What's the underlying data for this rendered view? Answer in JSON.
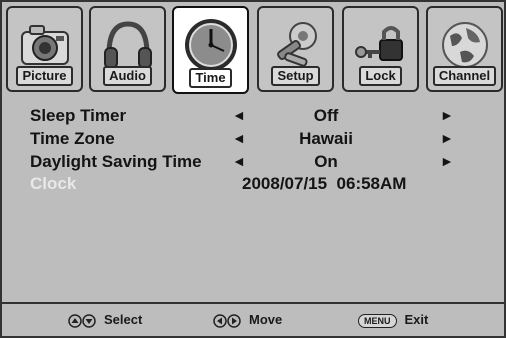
{
  "tabs": [
    {
      "label": "Picture",
      "icon": "camera-icon"
    },
    {
      "label": "Audio",
      "icon": "headphones-icon"
    },
    {
      "label": "Time",
      "icon": "clock-icon",
      "active": true
    },
    {
      "label": "Setup",
      "icon": "tools-icon"
    },
    {
      "label": "Lock",
      "icon": "lock-key-icon"
    },
    {
      "label": "Channel",
      "icon": "globe-icon"
    }
  ],
  "settings": {
    "sleep_timer": {
      "label": "Sleep Timer",
      "value": "Off"
    },
    "time_zone": {
      "label": "Time Zone",
      "value": "Hawaii"
    },
    "daylight_saving": {
      "label": "Daylight Saving Time",
      "value": "On"
    },
    "clock": {
      "label": "Clock",
      "value": "2008/07/15  06:58AM"
    }
  },
  "arrows": {
    "left": "◄",
    "right": "►"
  },
  "footer": {
    "select_label": "Select",
    "move_label": "Move",
    "menu_key": "MENU",
    "exit_label": "Exit"
  }
}
